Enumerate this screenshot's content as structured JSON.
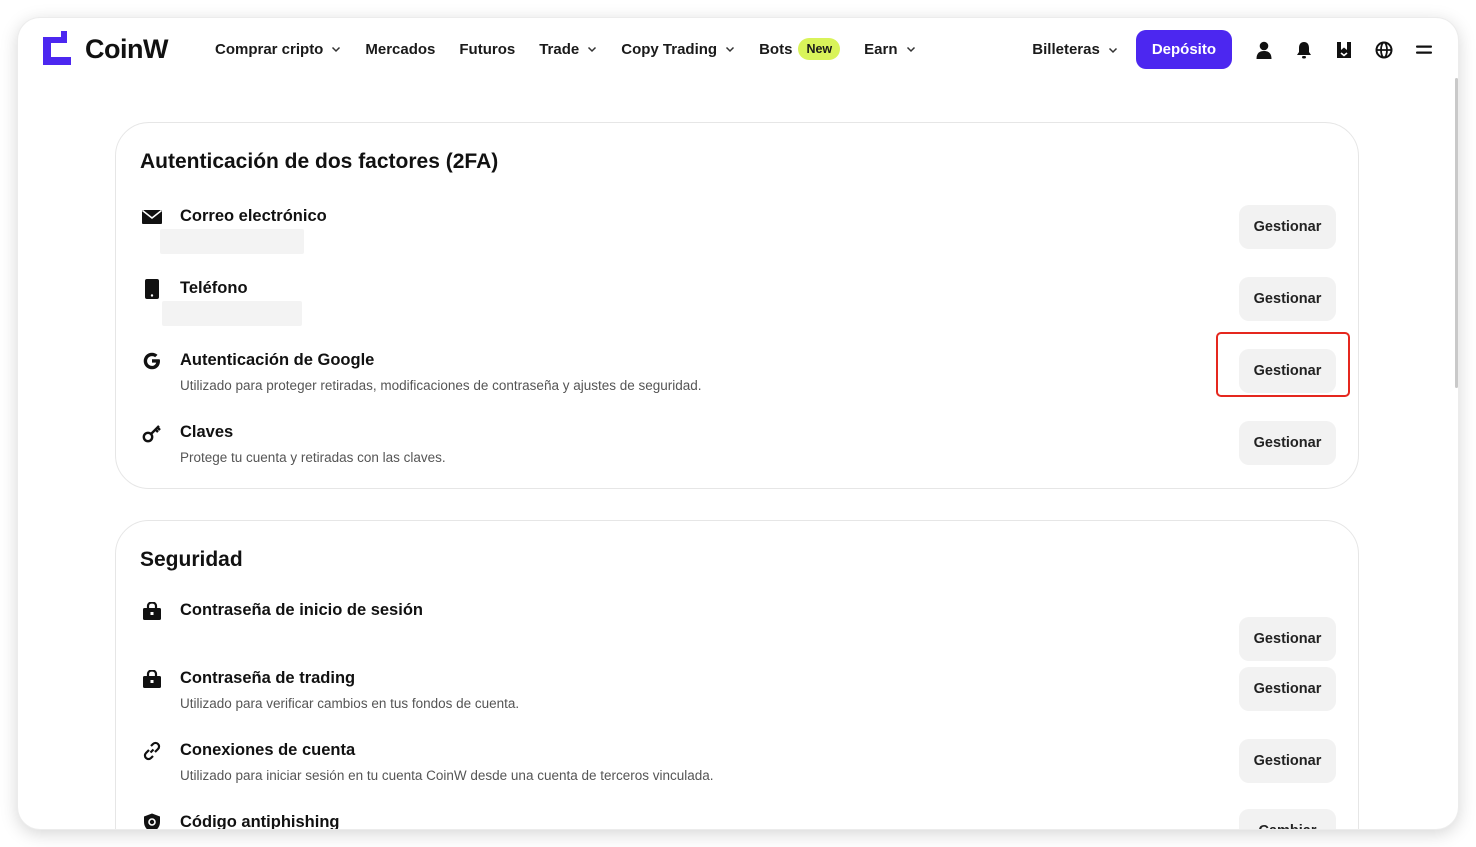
{
  "brand": {
    "name": "CoinW",
    "accent": "#4c27f0",
    "new_badge_color": "#d9f35a"
  },
  "nav": {
    "items": [
      {
        "label": "Comprar cripto",
        "dropdown": true
      },
      {
        "label": "Mercados",
        "dropdown": false
      },
      {
        "label": "Futuros",
        "dropdown": false
      },
      {
        "label": "Trade",
        "dropdown": true
      },
      {
        "label": "Copy Trading",
        "dropdown": true
      },
      {
        "label": "Bots",
        "badge": "New",
        "dropdown": false
      },
      {
        "label": "Earn",
        "dropdown": true
      }
    ],
    "wallets_label": "Billeteras",
    "deposit_label": "Depósito",
    "icons": [
      "user-icon",
      "bell-icon",
      "download-icon",
      "globe-icon",
      "menu-icon"
    ]
  },
  "twofa": {
    "title": "Autenticación de dos factores (2FA)",
    "rows": [
      {
        "icon": "mail-icon",
        "title": "Correo electrónico",
        "desc": "",
        "masked": true,
        "button": "Gestionar"
      },
      {
        "icon": "phone-icon",
        "title": "Teléfono",
        "desc": "",
        "masked": true,
        "button": "Gestionar"
      },
      {
        "icon": "google-icon",
        "title": "Autenticación de Google",
        "desc": "Utilizado para proteger retiradas, modificaciones de contraseña y ajustes de seguridad.",
        "masked": false,
        "button": "Gestionar",
        "highlighted": true
      },
      {
        "icon": "key-icon",
        "title": "Claves",
        "desc": "Protege tu cuenta y retiradas con las claves.",
        "masked": false,
        "button": "Gestionar"
      }
    ]
  },
  "security": {
    "title": "Seguridad",
    "rows": [
      {
        "icon": "lock-icon",
        "title": "Contraseña de inicio de sesión",
        "desc": "",
        "button": "Gestionar"
      },
      {
        "icon": "lock-icon",
        "title": "Contraseña de trading",
        "desc": "Utilizado para verificar cambios en tus fondos de cuenta.",
        "button": "Gestionar"
      },
      {
        "icon": "link-icon",
        "title": "Conexiones de cuenta",
        "desc": "Utilizado para iniciar sesión en tu cuenta CoinW desde una cuenta de terceros vinculada.",
        "button": "Gestionar"
      },
      {
        "icon": "shield-icon",
        "title": "Código antiphishing",
        "desc": "",
        "button": "Cambiar"
      }
    ]
  }
}
